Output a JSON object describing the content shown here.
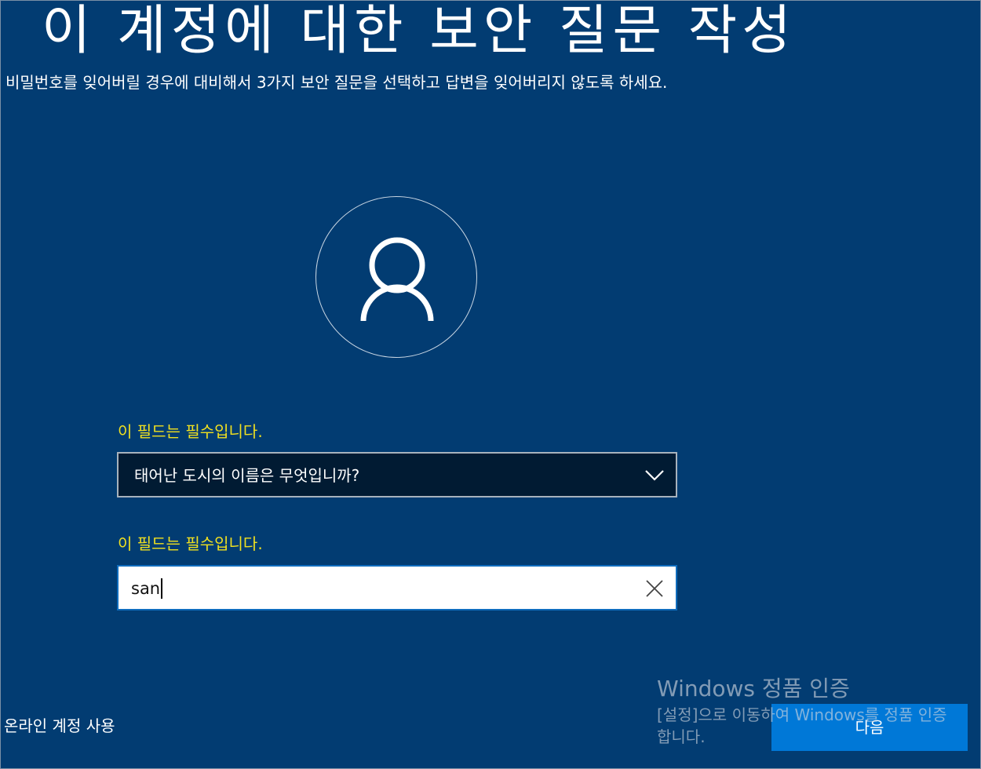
{
  "page": {
    "title": "이 계정에 대한 보안 질문 작성",
    "subtitle": "비밀번호를 잊어버릴 경우에 대비해서 3가지 보안 질문을 선택하고 답변을 잊어버리지 않도록 하세요."
  },
  "avatar": {
    "icon": "user-icon"
  },
  "question_field": {
    "required_message": "이 필드는 필수입니다.",
    "selected_value": "태어난 도시의 이름은 무엇입니까?",
    "icon": "chevron-down-icon"
  },
  "answer_field": {
    "required_message": "이 필드는 필수입니다.",
    "value": "san",
    "clear_icon": "close-icon"
  },
  "footer": {
    "online_account_link": "온라인 계정 사용",
    "next_button": "다음"
  },
  "activation_watermark": {
    "title": "Windows 정품 인증",
    "message": "[설정]으로 이동하여 Windows를 정품 인증합니다."
  },
  "colors": {
    "background": "#023c72",
    "accent": "#0078d7",
    "warning_text": "#f0e020",
    "select_background": "#011b33"
  }
}
